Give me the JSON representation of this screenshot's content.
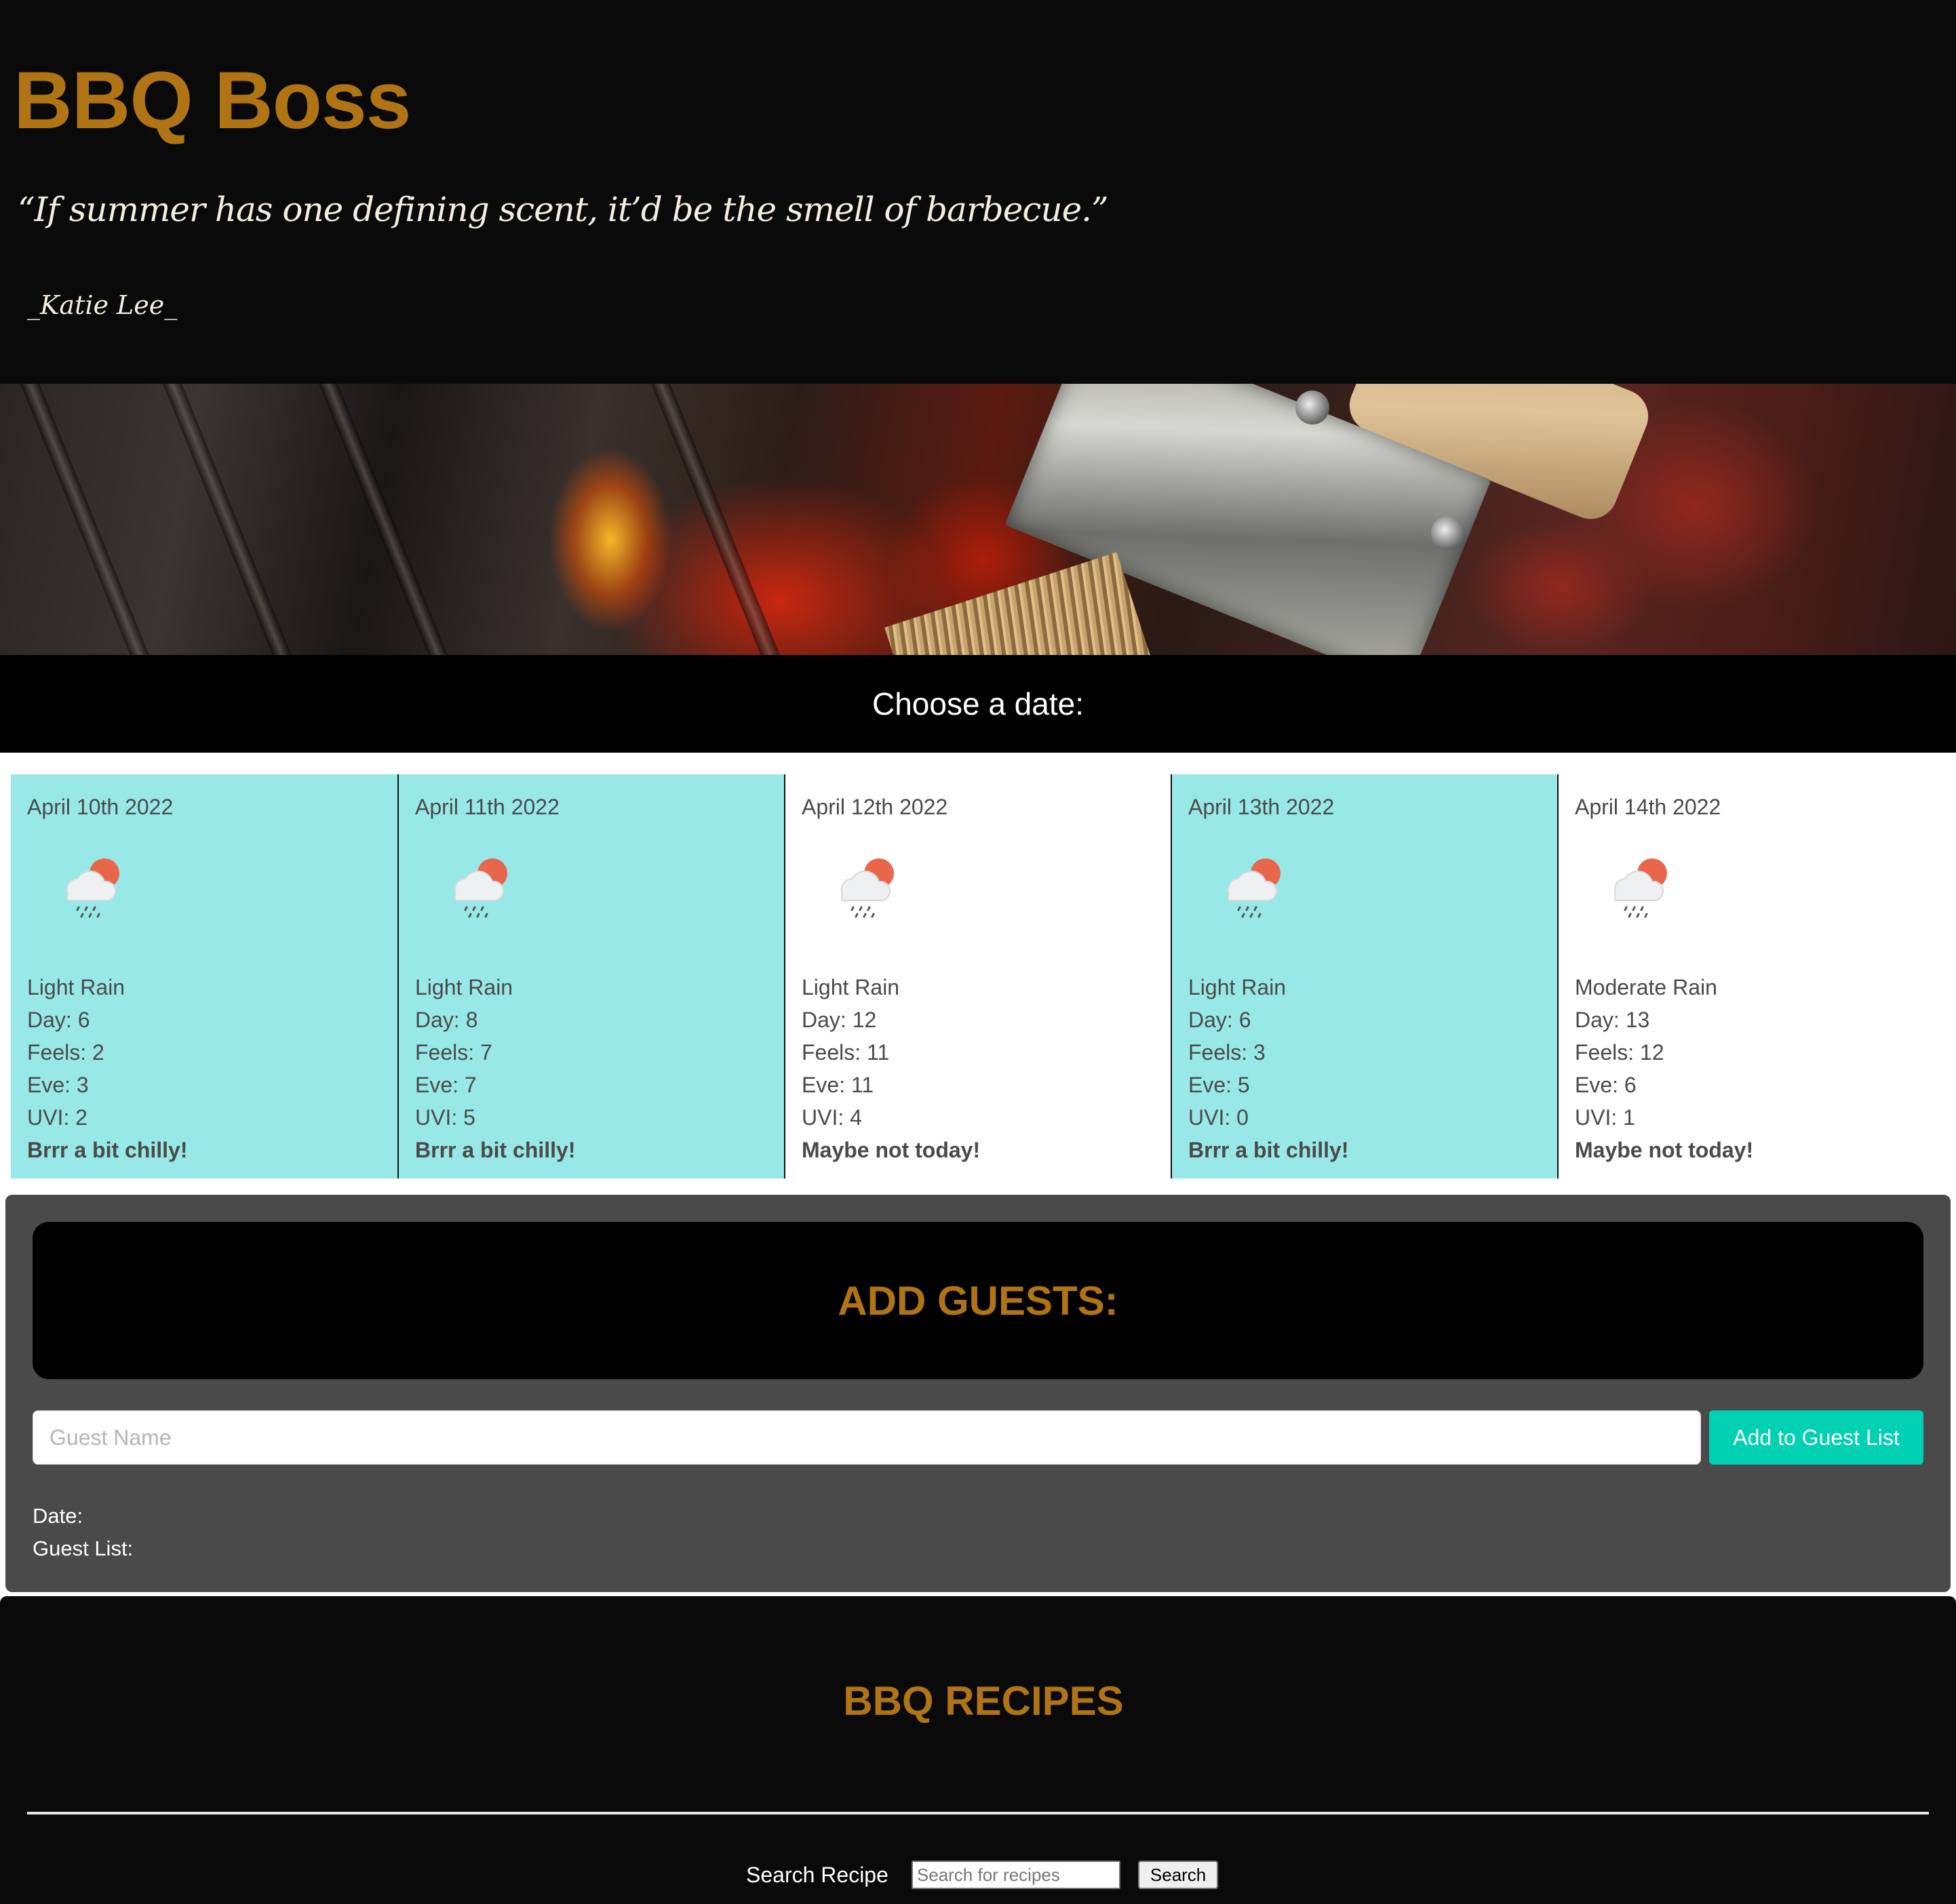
{
  "header": {
    "title": "BBQ Boss",
    "quote": "“If summer has one defining scent, it’d be the smell of barbecue.”",
    "author": "_Katie Lee_"
  },
  "choose_date": {
    "label": "Choose a date:"
  },
  "weather_cards": [
    {
      "date": "April 10th 2022",
      "condition": "Light Rain",
      "day": "Day: 6",
      "feels": "Feels: 2",
      "eve": "Eve: 3",
      "uvi": "UVI: 2",
      "verdict": "Brrr a bit chilly!",
      "icon": "rain-cloud-sun-icon",
      "tone": "cool"
    },
    {
      "date": "April 11th 2022",
      "condition": "Light Rain",
      "day": "Day: 8",
      "feels": "Feels: 7",
      "eve": "Eve: 7",
      "uvi": "UVI: 5",
      "verdict": "Brrr a bit chilly!",
      "icon": "rain-cloud-sun-icon",
      "tone": "cool"
    },
    {
      "date": "April 12th 2022",
      "condition": "Light Rain",
      "day": "Day: 12",
      "feels": "Feels: 11",
      "eve": "Eve: 11",
      "uvi": "UVI: 4",
      "verdict": "Maybe not today!",
      "icon": "rain-cloud-sun-icon",
      "tone": "warm"
    },
    {
      "date": "April 13th 2022",
      "condition": "Light Rain",
      "day": "Day: 6",
      "feels": "Feels: 3",
      "eve": "Eve: 5",
      "uvi": "UVI: 0",
      "verdict": "Brrr a bit chilly!",
      "icon": "rain-cloud-sun-icon",
      "tone": "cool"
    },
    {
      "date": "April 14th 2022",
      "condition": "Moderate Rain",
      "day": "Day: 13",
      "feels": "Feels: 12",
      "eve": "Eve: 6",
      "uvi": "UVI: 1",
      "verdict": "Maybe not today!",
      "icon": "rain-cloud-sun-icon",
      "tone": "warm"
    }
  ],
  "guests": {
    "title": "ADD GUESTS:",
    "input_placeholder": "Guest Name",
    "input_value": "",
    "add_button": "Add to Guest List",
    "date_label": "Date:",
    "guest_list_label": "Guest List:"
  },
  "recipes": {
    "title": "BBQ RECIPES",
    "search_label": "Search Recipe",
    "search_placeholder": "Search for recipes",
    "search_button": "Search"
  },
  "colors": {
    "brand": "#b07414",
    "card_cool": "#98e8e8",
    "card_warm": "#ffffff",
    "accent_button": "#00d1b2",
    "panel": "#4a4a4a"
  }
}
